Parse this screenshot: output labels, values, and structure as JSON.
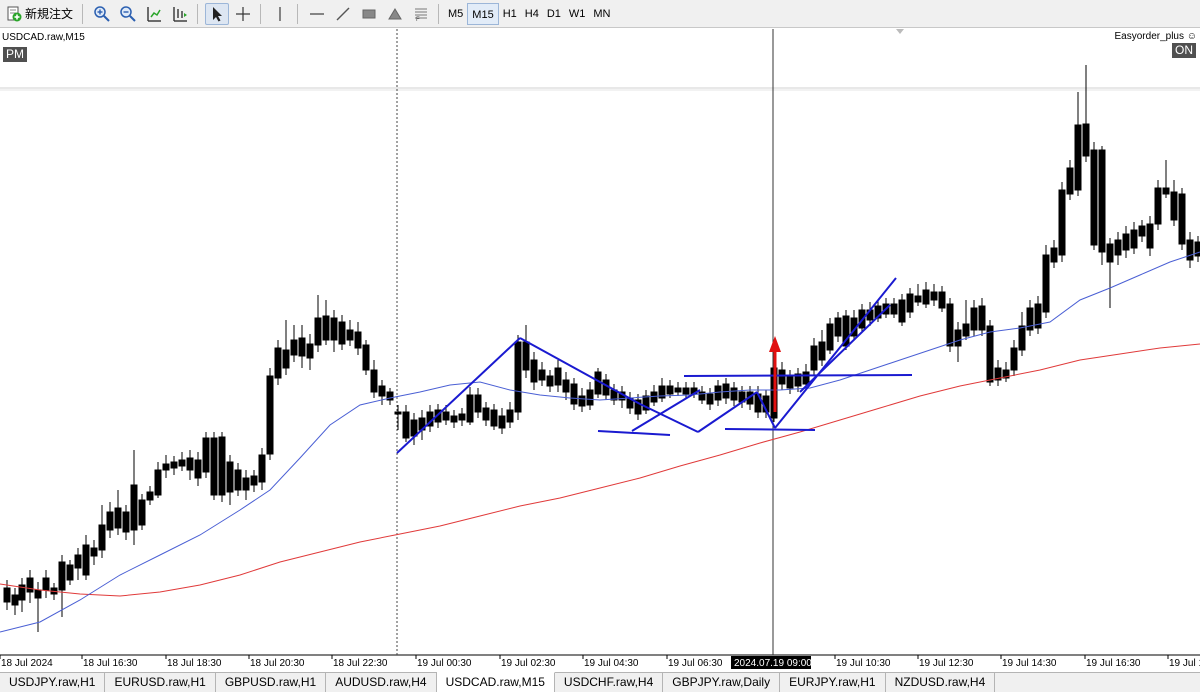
{
  "toolbar": {
    "new_order_label": "新規注文",
    "timeframes": [
      "M5",
      "M15",
      "H1",
      "H4",
      "D1",
      "W1",
      "MN"
    ],
    "active_timeframe": "M15"
  },
  "chart": {
    "title": "USDCAD.raw,M15",
    "session_badge": "PM",
    "ea_label": "Easyorder_plus ☺",
    "ea_status": "ON",
    "time_labels": [
      "18 Jul 2024",
      "18 Jul 16:30",
      "18 Jul 18:30",
      "18 Jul 20:30",
      "18 Jul 22:30",
      "19 Jul 00:30",
      "19 Jul 02:30",
      "19 Jul 04:30",
      "19 Jul 06:30",
      "19 Jul 10:30",
      "19 Jul 12:30",
      "19 Jul 14:30",
      "19 Jul 16:30",
      "19 Jul 1"
    ],
    "crosshair_time": "2024.07.19 09:00",
    "colors": {
      "fast_ma": "#4a5fd4",
      "slow_ma": "#e03a3a",
      "pattern_lines": "#1a1ad0",
      "arrow": "#e01010"
    }
  },
  "tabs": [
    "USDJPY.raw,H1",
    "EURUSD.raw,H1",
    "GBPUSD.raw,H1",
    "AUDUSD.raw,H4",
    "USDCAD.raw,M15",
    "USDCHF.raw,H4",
    "GBPJPY.raw,Daily",
    "EURJPY.raw,H1",
    "NZDUSD.raw,H4"
  ],
  "active_tab": "USDCAD.raw,M15"
}
